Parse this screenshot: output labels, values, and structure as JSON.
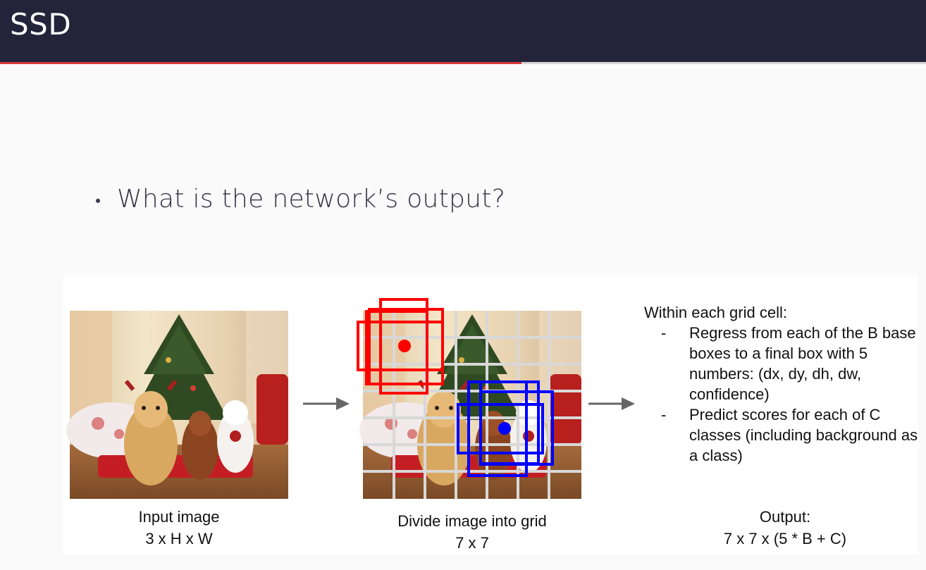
{
  "slide": {
    "title": "SSD",
    "progress": 0.563,
    "bullet": "What is the network’s output?"
  },
  "figure": {
    "input_image": {
      "line1": "Input image",
      "line2": "3 x H x W"
    },
    "grid_image": {
      "line1": "Divide image into grid",
      "line2": "7 x 7"
    },
    "description": {
      "heading": "Within each grid cell:",
      "items": [
        {
          "dash": "-",
          "text": "Regress from each of the B base boxes to a final box with 5 numbers: (dx, dy, dh, dw, confidence)"
        },
        {
          "dash": "-",
          "text": "Predict scores for each of C classes (including background as a class)"
        }
      ]
    },
    "output": {
      "line1": "Output:",
      "line2": "7 x 7 x (5 * B + C)"
    },
    "colors": {
      "anchor_red": "#ff0000",
      "anchor_blue": "#0000ff",
      "arrow": "#666666"
    }
  }
}
